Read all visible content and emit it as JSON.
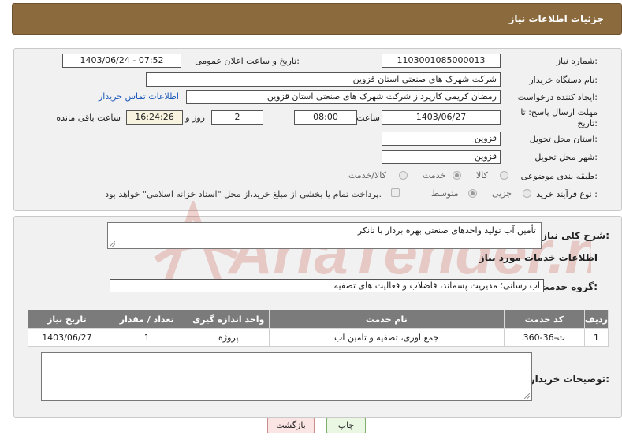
{
  "header": {
    "title": "جزئیات اطلاعات نیاز"
  },
  "form": {
    "need_number_label": "شماره نیاز:",
    "need_number": "1103001085000013",
    "announce_label": "تاریخ و ساعت اعلان عمومی:",
    "announce_value": "1403/06/24 - 07:52",
    "buyer_org_label": "نام دستگاه خریدار:",
    "buyer_org": "شرکت شهرک های صنعتی استان قزوین",
    "requester_label": "ایجاد کننده درخواست:",
    "requester": "رمضان کریمی کارپرداز شرکت شهرک های صنعتی استان قزوین",
    "contact_link": "اطلاعات تماس خریدار",
    "deadline_label_1": "مهلت ارسال پاسخ: تا",
    "deadline_label_2": "تاریخ:",
    "deadline_date": "1403/06/27",
    "time_label": "ساعت",
    "deadline_time": "08:00",
    "days_value": "2",
    "days_label": "روز و",
    "remaining_time": "16:24:26",
    "remaining_label": "ساعت باقی مانده",
    "province_label": "استان محل تحویل:",
    "province": "قزوین",
    "city_label": "شهر محل تحویل:",
    "city": "قزوین",
    "category_label": "طبقه بندی موضوعی:",
    "category_options": [
      "کالا",
      "خدمت",
      "کالا/خدمت"
    ],
    "category_selected": "خدمت",
    "process_label": "نوع فرآیند خرید :",
    "process_options": [
      "جزیی",
      "متوسط"
    ],
    "process_selected": "متوسط",
    "payment_note": "پرداخت تمام یا بخشی از مبلغ خرید،از محل \"اسناد خزانه اسلامی\" خواهد بود."
  },
  "summary": {
    "label": "شرح کلی نیاز:",
    "value": "تأمین آب تولید واحدهای صنعتی بهره بردار با تانکر",
    "services_heading": "اطلاعات خدمات مورد نیاز",
    "group_label": "گروه خدمت:",
    "group_value": "آب رسانی؛ مدیریت پسماند، فاضلاب و فعالیت های تصفیه"
  },
  "table": {
    "headers": [
      "ردیف",
      "کد خدمت",
      "نام خدمت",
      "واحد اندازه گیری",
      "تعداد / مقدار",
      "تاریخ نیاز"
    ],
    "rows": [
      [
        "1",
        "ث-36-360",
        "جمع آوری، تصفیه و تامین آب",
        "پروژه",
        "1",
        "1403/06/27"
      ]
    ]
  },
  "notes": {
    "label": "توضیحات خریدار:"
  },
  "buttons": {
    "print": "چاپ",
    "back": "بازگشت"
  },
  "watermark": {
    "text": "AriaTender.neT"
  },
  "colors": {
    "header_bg": "#8b6a3e",
    "table_header": "#7b7b7b",
    "link": "#1a57b8",
    "watermark": "#c0392b"
  }
}
